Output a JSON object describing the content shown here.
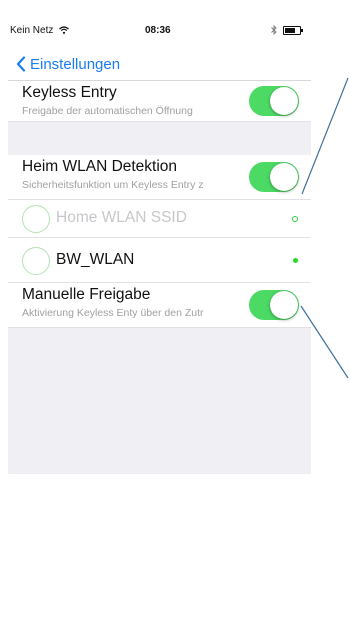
{
  "status_bar": {
    "carrier": "Kein Netz",
    "time": "08:36"
  },
  "nav": {
    "back_label": "Einstellungen"
  },
  "keyless": {
    "title": "Keyless Entry",
    "subtitle": "Freigabe der automatischen Öffnung"
  },
  "wlan": {
    "title": "Heim WLAN Detektion",
    "subtitle": "Sicherheitsfunktion um Keyless Entry z"
  },
  "ssids": [
    {
      "label": "Home WLAN SSID",
      "color": "#c8c8cc",
      "dot": "hollow"
    },
    {
      "label": "BW_WLAN",
      "color": "#111111",
      "dot": "filled"
    }
  ],
  "manual": {
    "title": "Manuelle Freigabe",
    "subtitle": "Aktivierung Keyless Enty über den Zutr"
  },
  "colors": {
    "accent": "#1a7cf5",
    "toggle_on": "#4cd964",
    "group_bg": "#efeff4"
  }
}
